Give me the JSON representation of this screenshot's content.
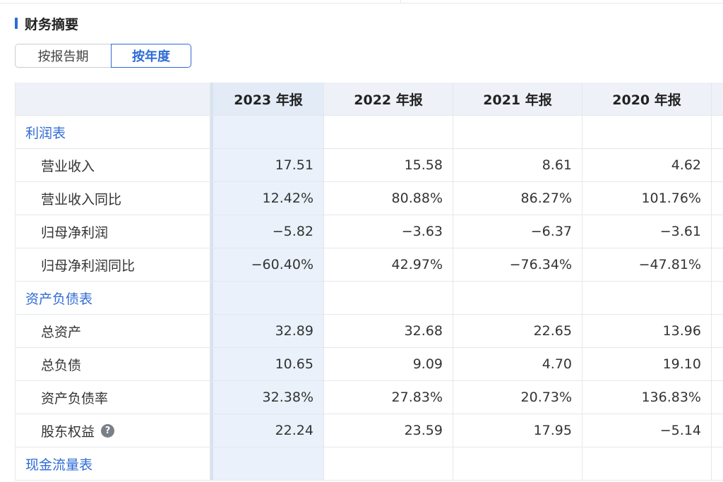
{
  "title": "财务摘要",
  "tabs": [
    {
      "label": "按报告期"
    },
    {
      "label": "按年度"
    }
  ],
  "columns": [
    "2023 年报",
    "2022 年报",
    "2021 年报",
    "2020 年报"
  ],
  "sections": [
    {
      "label": "利润表",
      "rows": [
        {
          "label": "营业收入",
          "values": [
            "17.51",
            "15.58",
            "8.61",
            "4.62"
          ]
        },
        {
          "label": "营业收入同比",
          "values": [
            "12.42%",
            "80.88%",
            "86.27%",
            "101.76%"
          ]
        },
        {
          "label": "归母净利润",
          "values": [
            "−5.82",
            "−3.63",
            "−6.37",
            "−3.61"
          ]
        },
        {
          "label": "归母净利润同比",
          "values": [
            "−60.40%",
            "42.97%",
            "−76.34%",
            "−47.81%"
          ]
        }
      ]
    },
    {
      "label": "资产负债表",
      "rows": [
        {
          "label": "总资产",
          "values": [
            "32.89",
            "32.68",
            "22.65",
            "13.96"
          ]
        },
        {
          "label": "总负债",
          "values": [
            "10.65",
            "9.09",
            "4.70",
            "19.10"
          ]
        },
        {
          "label": "资产负债率",
          "values": [
            "32.38%",
            "27.83%",
            "20.73%",
            "136.83%"
          ]
        },
        {
          "label": "股东权益",
          "help": "?",
          "values": [
            "22.24",
            "23.59",
            "17.95",
            "−5.14"
          ]
        }
      ]
    },
    {
      "label": "现金流量表",
      "rows": []
    }
  ],
  "colors": {
    "accent": "#2e6bd6",
    "header_bg": "#eef1f7",
    "highlight_col": "#eaf1fb"
  }
}
